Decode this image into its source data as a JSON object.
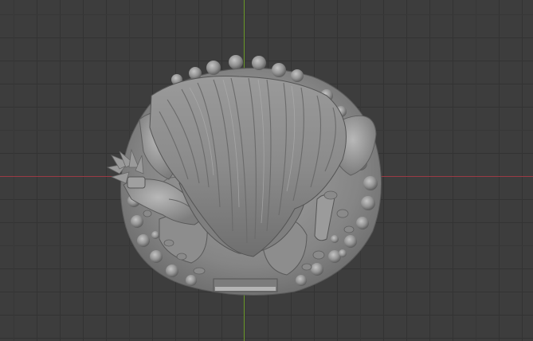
{
  "viewport": {
    "mode": "3d-viewport",
    "view": "top",
    "background_color": "#3d3d3d",
    "grid_color": "#333333",
    "x_axis_color": "#9b3a44",
    "y_axis_color": "#6c9a2a",
    "object": {
      "name": "sculpted-figure-mesh",
      "shading": "solid",
      "color": "#8f8f8f"
    }
  }
}
